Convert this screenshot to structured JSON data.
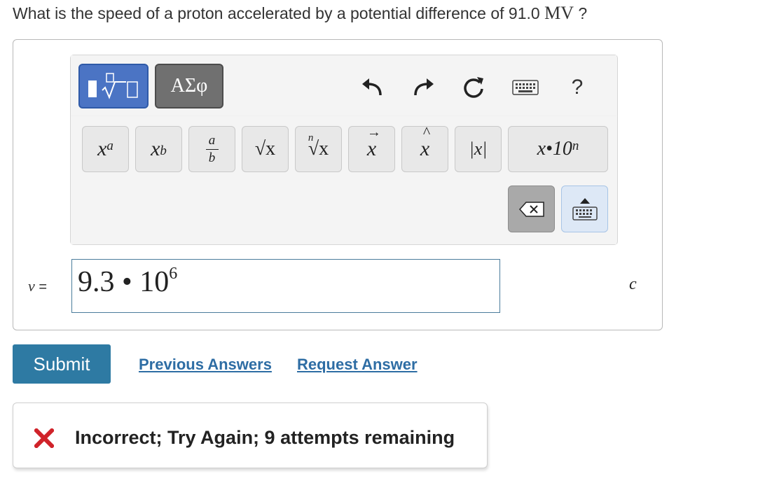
{
  "question": {
    "text": "What is the speed of a proton accelerated by a potential difference of 91.0 ",
    "unit": "MV",
    "suffix": " ?"
  },
  "toolbar": {
    "mode_templates_icon": "templates-icon",
    "mode_greek_label": "ΑΣφ",
    "undo_icon": "undo-icon",
    "redo_icon": "redo-icon",
    "reset_icon": "reset-icon",
    "keyboard_icon": "keyboard-icon",
    "help_label": "?"
  },
  "keys": {
    "superscript_base": "x",
    "superscript_exp": "a",
    "subscript_base": "x",
    "subscript_sub": "b",
    "fraction_num": "a",
    "fraction_den": "b",
    "sqrt_label": "√x",
    "nthroot_index": "n",
    "nthroot_label": "√x",
    "vector_arrow": "→",
    "vector_base": "x",
    "hat_mark": "^",
    "hat_base": "x",
    "abs_label": "|x|",
    "sci_label": "x•10",
    "sci_exp": "n"
  },
  "answer": {
    "variable": "v",
    "equals": "=",
    "mantissa": "9.3 • 10",
    "exponent": "6",
    "unit": "c"
  },
  "actions": {
    "submit_label": "Submit",
    "previous_answers_label": "Previous Answers",
    "request_answer_label": "Request Answer"
  },
  "feedback": {
    "text": "Incorrect; Try Again; 9 attempts remaining"
  },
  "colors": {
    "accent": "#2e7aa3",
    "link": "#2e6da4",
    "error": "#d0232a",
    "mode_active": "#4b74c4"
  }
}
